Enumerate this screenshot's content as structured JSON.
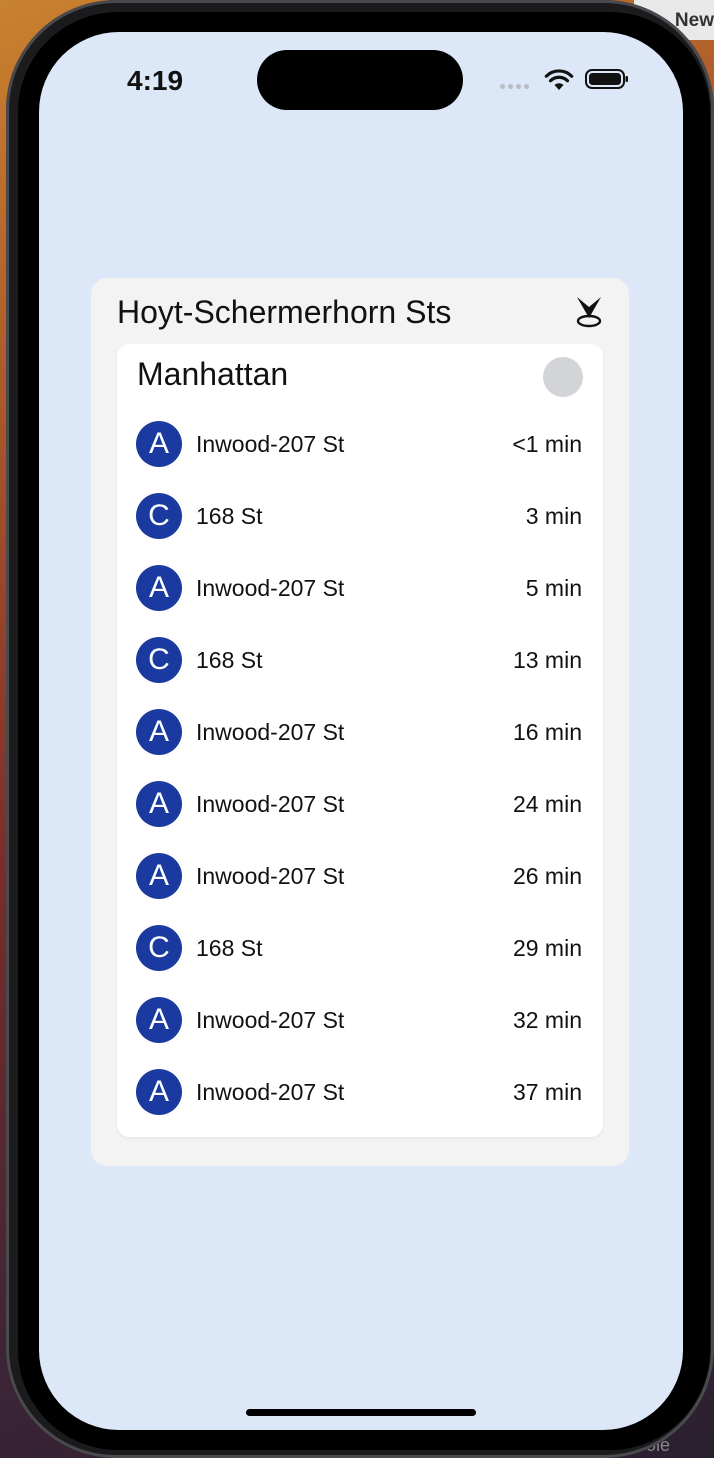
{
  "desktop": {
    "corner_text": "New",
    "bottom_text": "ole"
  },
  "status_bar": {
    "time": "4:19"
  },
  "station": {
    "name": "Hoyt-Schermerhorn Sts"
  },
  "direction": {
    "label": "Manhattan"
  },
  "colors": {
    "route_bullet": "#1a3aa0",
    "screen_bg": "#dce7f8"
  },
  "arrivals": [
    {
      "route": "A",
      "destination": "Inwood-207 St",
      "eta": "<1 min"
    },
    {
      "route": "C",
      "destination": "168 St",
      "eta": "3 min"
    },
    {
      "route": "A",
      "destination": "Inwood-207 St",
      "eta": "5 min"
    },
    {
      "route": "C",
      "destination": "168 St",
      "eta": "13 min"
    },
    {
      "route": "A",
      "destination": "Inwood-207 St",
      "eta": "16 min"
    },
    {
      "route": "A",
      "destination": "Inwood-207 St",
      "eta": "24 min"
    },
    {
      "route": "A",
      "destination": "Inwood-207 St",
      "eta": "26 min"
    },
    {
      "route": "C",
      "destination": "168 St",
      "eta": "29 min"
    },
    {
      "route": "A",
      "destination": "Inwood-207 St",
      "eta": "32 min"
    },
    {
      "route": "A",
      "destination": "Inwood-207 St",
      "eta": "37 min"
    }
  ]
}
